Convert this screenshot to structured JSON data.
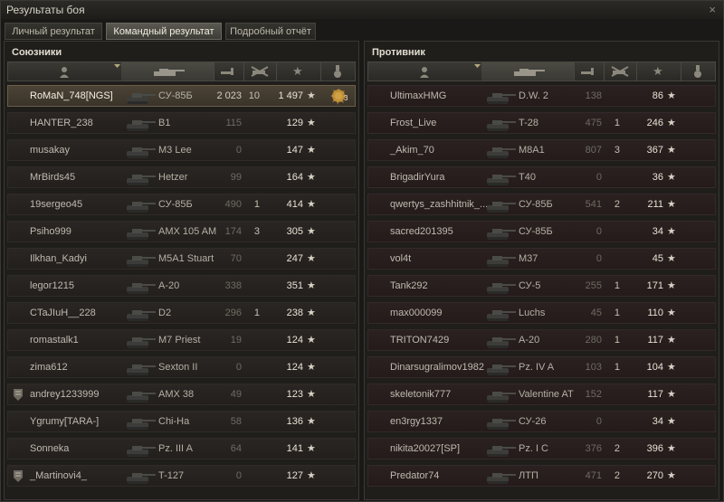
{
  "window": {
    "title": "Результаты боя",
    "close": "×"
  },
  "tabs": [
    {
      "label": "Личный результат"
    },
    {
      "label": "Командный результат"
    },
    {
      "label": "Подробный отчёт"
    }
  ],
  "active_tab": 1,
  "allies": {
    "title": "Союзники",
    "rows": [
      {
        "name": "RoMaN_748[NGS]",
        "vehicle": "СУ-85Б",
        "damage": "2 023",
        "kills": "10",
        "xp": "1 497",
        "me": true,
        "medal": "3"
      },
      {
        "name": "HANTER_238",
        "vehicle": "B1",
        "damage": "115",
        "kills": "",
        "xp": "129"
      },
      {
        "name": "musakay",
        "vehicle": "M3 Lee",
        "damage": "0",
        "kills": "",
        "xp": "147"
      },
      {
        "name": "MrBirds45",
        "vehicle": "Hetzer",
        "damage": "99",
        "kills": "",
        "xp": "164"
      },
      {
        "name": "19sergeo45",
        "vehicle": "СУ-85Б",
        "damage": "490",
        "kills": "1",
        "xp": "414"
      },
      {
        "name": "Psiho999",
        "vehicle": "AMX 105 AM",
        "damage": "174",
        "kills": "3",
        "xp": "305"
      },
      {
        "name": "Ilkhan_Kadyi",
        "vehicle": "M5A1 Stuart",
        "damage": "70",
        "kills": "",
        "xp": "247"
      },
      {
        "name": "legor1215",
        "vehicle": "A-20",
        "damage": "338",
        "kills": "",
        "xp": "351"
      },
      {
        "name": "CTaJIuH__228",
        "vehicle": "D2",
        "damage": "296",
        "kills": "1",
        "xp": "238"
      },
      {
        "name": "romastalk1",
        "vehicle": "M7 Priest",
        "damage": "19",
        "kills": "",
        "xp": "124"
      },
      {
        "name": "zima612",
        "vehicle": "Sexton II",
        "damage": "0",
        "kills": "",
        "xp": "124"
      },
      {
        "name": "andrey1233999",
        "vehicle": "AMX 38",
        "damage": "49",
        "kills": "",
        "xp": "123",
        "platoon": true
      },
      {
        "name": "Ygrumy[TARA-]",
        "vehicle": "Chi-Ha",
        "damage": "58",
        "kills": "",
        "xp": "136"
      },
      {
        "name": "Sonneka",
        "vehicle": "Pz. III A",
        "damage": "64",
        "kills": "",
        "xp": "141"
      },
      {
        "name": "_Martinovi4_",
        "vehicle": "T-127",
        "damage": "0",
        "kills": "",
        "xp": "127",
        "platoon": true
      }
    ]
  },
  "enemies": {
    "title": "Противник",
    "rows": [
      {
        "name": "UltimaxHMG",
        "vehicle": "D.W. 2",
        "damage": "138",
        "kills": "",
        "xp": "86"
      },
      {
        "name": "Frost_Live",
        "vehicle": "T-28",
        "damage": "475",
        "kills": "1",
        "xp": "246"
      },
      {
        "name": "_Akim_70",
        "vehicle": "M8A1",
        "damage": "807",
        "kills": "3",
        "xp": "367"
      },
      {
        "name": "BrigadirYura",
        "vehicle": "T40",
        "damage": "0",
        "kills": "",
        "xp": "36"
      },
      {
        "name": "qwertys_zashhitnik_...",
        "vehicle": "СУ-85Б",
        "damage": "541",
        "kills": "2",
        "xp": "211"
      },
      {
        "name": "sacred201395",
        "vehicle": "СУ-85Б",
        "damage": "0",
        "kills": "",
        "xp": "34"
      },
      {
        "name": "vol4t",
        "vehicle": "M37",
        "damage": "0",
        "kills": "",
        "xp": "45"
      },
      {
        "name": "Tank292",
        "vehicle": "СУ-5",
        "damage": "255",
        "kills": "1",
        "xp": "171"
      },
      {
        "name": "max000099",
        "vehicle": "Luchs",
        "damage": "45",
        "kills": "1",
        "xp": "110"
      },
      {
        "name": "TRITON7429",
        "vehicle": "A-20",
        "damage": "280",
        "kills": "1",
        "xp": "117"
      },
      {
        "name": "Dinarsugralimov1982",
        "vehicle": "Pz. IV A",
        "damage": "103",
        "kills": "1",
        "xp": "104"
      },
      {
        "name": "skeletonik777",
        "vehicle": "Valentine AT",
        "damage": "152",
        "kills": "",
        "xp": "117"
      },
      {
        "name": "en3rgy1337",
        "vehicle": "СУ-26",
        "damage": "0",
        "kills": "",
        "xp": "34"
      },
      {
        "name": "nikita20027[SP]",
        "vehicle": "Pz. I C",
        "damage": "376",
        "kills": "2",
        "xp": "396"
      },
      {
        "name": "Predator74",
        "vehicle": "ЛТП",
        "damage": "471",
        "kills": "2",
        "xp": "270"
      }
    ]
  },
  "icons": {
    "player_col": "player-icon",
    "tank_col": "tank-icon",
    "damage_col": "damage-icon",
    "kills_col": "kills-icon",
    "xp_col": "star-icon",
    "medal_col": "medal-icon",
    "star": "★",
    "sort": "sort-chevron-icon"
  },
  "colors": {
    "my_row": "#4b4335",
    "ally_row": "#2a2623",
    "enemy_row": "#2b2120"
  }
}
